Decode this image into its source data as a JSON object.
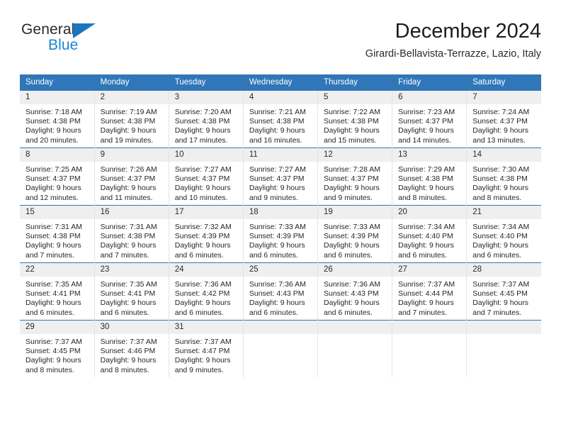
{
  "brand": {
    "name_part1": "General",
    "name_part2": "Blue",
    "triangle_color": "#1b76bc",
    "text_color": "#2b2b2b",
    "blue_color": "#1b86d0"
  },
  "header": {
    "title": "December 2024",
    "subtitle": "Girardi-Bellavista-Terrazze, Lazio, Italy"
  },
  "theme": {
    "header_bg": "#3076b8",
    "header_text": "#ffffff",
    "daynum_bg": "#efefef",
    "grid_line": "#e3e3e3",
    "week_separator": "#3076b8"
  },
  "weekdays": [
    "Sunday",
    "Monday",
    "Tuesday",
    "Wednesday",
    "Thursday",
    "Friday",
    "Saturday"
  ],
  "labels": {
    "sunrise_prefix": "Sunrise:",
    "sunset_prefix": "Sunset:",
    "daylight_prefix": "Daylight:"
  },
  "weeks": [
    [
      {
        "day": "1",
        "sunrise": "Sunrise: 7:18 AM",
        "sunset": "Sunset: 4:38 PM",
        "daylight1": "Daylight: 9 hours",
        "daylight2": "and 20 minutes."
      },
      {
        "day": "2",
        "sunrise": "Sunrise: 7:19 AM",
        "sunset": "Sunset: 4:38 PM",
        "daylight1": "Daylight: 9 hours",
        "daylight2": "and 19 minutes."
      },
      {
        "day": "3",
        "sunrise": "Sunrise: 7:20 AM",
        "sunset": "Sunset: 4:38 PM",
        "daylight1": "Daylight: 9 hours",
        "daylight2": "and 17 minutes."
      },
      {
        "day": "4",
        "sunrise": "Sunrise: 7:21 AM",
        "sunset": "Sunset: 4:38 PM",
        "daylight1": "Daylight: 9 hours",
        "daylight2": "and 16 minutes."
      },
      {
        "day": "5",
        "sunrise": "Sunrise: 7:22 AM",
        "sunset": "Sunset: 4:38 PM",
        "daylight1": "Daylight: 9 hours",
        "daylight2": "and 15 minutes."
      },
      {
        "day": "6",
        "sunrise": "Sunrise: 7:23 AM",
        "sunset": "Sunset: 4:37 PM",
        "daylight1": "Daylight: 9 hours",
        "daylight2": "and 14 minutes."
      },
      {
        "day": "7",
        "sunrise": "Sunrise: 7:24 AM",
        "sunset": "Sunset: 4:37 PM",
        "daylight1": "Daylight: 9 hours",
        "daylight2": "and 13 minutes."
      }
    ],
    [
      {
        "day": "8",
        "sunrise": "Sunrise: 7:25 AM",
        "sunset": "Sunset: 4:37 PM",
        "daylight1": "Daylight: 9 hours",
        "daylight2": "and 12 minutes."
      },
      {
        "day": "9",
        "sunrise": "Sunrise: 7:26 AM",
        "sunset": "Sunset: 4:37 PM",
        "daylight1": "Daylight: 9 hours",
        "daylight2": "and 11 minutes."
      },
      {
        "day": "10",
        "sunrise": "Sunrise: 7:27 AM",
        "sunset": "Sunset: 4:37 PM",
        "daylight1": "Daylight: 9 hours",
        "daylight2": "and 10 minutes."
      },
      {
        "day": "11",
        "sunrise": "Sunrise: 7:27 AM",
        "sunset": "Sunset: 4:37 PM",
        "daylight1": "Daylight: 9 hours",
        "daylight2": "and 9 minutes."
      },
      {
        "day": "12",
        "sunrise": "Sunrise: 7:28 AM",
        "sunset": "Sunset: 4:37 PM",
        "daylight1": "Daylight: 9 hours",
        "daylight2": "and 9 minutes."
      },
      {
        "day": "13",
        "sunrise": "Sunrise: 7:29 AM",
        "sunset": "Sunset: 4:38 PM",
        "daylight1": "Daylight: 9 hours",
        "daylight2": "and 8 minutes."
      },
      {
        "day": "14",
        "sunrise": "Sunrise: 7:30 AM",
        "sunset": "Sunset: 4:38 PM",
        "daylight1": "Daylight: 9 hours",
        "daylight2": "and 8 minutes."
      }
    ],
    [
      {
        "day": "15",
        "sunrise": "Sunrise: 7:31 AM",
        "sunset": "Sunset: 4:38 PM",
        "daylight1": "Daylight: 9 hours",
        "daylight2": "and 7 minutes."
      },
      {
        "day": "16",
        "sunrise": "Sunrise: 7:31 AM",
        "sunset": "Sunset: 4:38 PM",
        "daylight1": "Daylight: 9 hours",
        "daylight2": "and 7 minutes."
      },
      {
        "day": "17",
        "sunrise": "Sunrise: 7:32 AM",
        "sunset": "Sunset: 4:39 PM",
        "daylight1": "Daylight: 9 hours",
        "daylight2": "and 6 minutes."
      },
      {
        "day": "18",
        "sunrise": "Sunrise: 7:33 AM",
        "sunset": "Sunset: 4:39 PM",
        "daylight1": "Daylight: 9 hours",
        "daylight2": "and 6 minutes."
      },
      {
        "day": "19",
        "sunrise": "Sunrise: 7:33 AM",
        "sunset": "Sunset: 4:39 PM",
        "daylight1": "Daylight: 9 hours",
        "daylight2": "and 6 minutes."
      },
      {
        "day": "20",
        "sunrise": "Sunrise: 7:34 AM",
        "sunset": "Sunset: 4:40 PM",
        "daylight1": "Daylight: 9 hours",
        "daylight2": "and 6 minutes."
      },
      {
        "day": "21",
        "sunrise": "Sunrise: 7:34 AM",
        "sunset": "Sunset: 4:40 PM",
        "daylight1": "Daylight: 9 hours",
        "daylight2": "and 6 minutes."
      }
    ],
    [
      {
        "day": "22",
        "sunrise": "Sunrise: 7:35 AM",
        "sunset": "Sunset: 4:41 PM",
        "daylight1": "Daylight: 9 hours",
        "daylight2": "and 6 minutes."
      },
      {
        "day": "23",
        "sunrise": "Sunrise: 7:35 AM",
        "sunset": "Sunset: 4:41 PM",
        "daylight1": "Daylight: 9 hours",
        "daylight2": "and 6 minutes."
      },
      {
        "day": "24",
        "sunrise": "Sunrise: 7:36 AM",
        "sunset": "Sunset: 4:42 PM",
        "daylight1": "Daylight: 9 hours",
        "daylight2": "and 6 minutes."
      },
      {
        "day": "25",
        "sunrise": "Sunrise: 7:36 AM",
        "sunset": "Sunset: 4:43 PM",
        "daylight1": "Daylight: 9 hours",
        "daylight2": "and 6 minutes."
      },
      {
        "day": "26",
        "sunrise": "Sunrise: 7:36 AM",
        "sunset": "Sunset: 4:43 PM",
        "daylight1": "Daylight: 9 hours",
        "daylight2": "and 6 minutes."
      },
      {
        "day": "27",
        "sunrise": "Sunrise: 7:37 AM",
        "sunset": "Sunset: 4:44 PM",
        "daylight1": "Daylight: 9 hours",
        "daylight2": "and 7 minutes."
      },
      {
        "day": "28",
        "sunrise": "Sunrise: 7:37 AM",
        "sunset": "Sunset: 4:45 PM",
        "daylight1": "Daylight: 9 hours",
        "daylight2": "and 7 minutes."
      }
    ],
    [
      {
        "day": "29",
        "sunrise": "Sunrise: 7:37 AM",
        "sunset": "Sunset: 4:45 PM",
        "daylight1": "Daylight: 9 hours",
        "daylight2": "and 8 minutes."
      },
      {
        "day": "30",
        "sunrise": "Sunrise: 7:37 AM",
        "sunset": "Sunset: 4:46 PM",
        "daylight1": "Daylight: 9 hours",
        "daylight2": "and 8 minutes."
      },
      {
        "day": "31",
        "sunrise": "Sunrise: 7:37 AM",
        "sunset": "Sunset: 4:47 PM",
        "daylight1": "Daylight: 9 hours",
        "daylight2": "and 9 minutes."
      },
      {
        "day": "",
        "sunrise": "",
        "sunset": "",
        "daylight1": "",
        "daylight2": ""
      },
      {
        "day": "",
        "sunrise": "",
        "sunset": "",
        "daylight1": "",
        "daylight2": ""
      },
      {
        "day": "",
        "sunrise": "",
        "sunset": "",
        "daylight1": "",
        "daylight2": ""
      },
      {
        "day": "",
        "sunrise": "",
        "sunset": "",
        "daylight1": "",
        "daylight2": ""
      }
    ]
  ]
}
